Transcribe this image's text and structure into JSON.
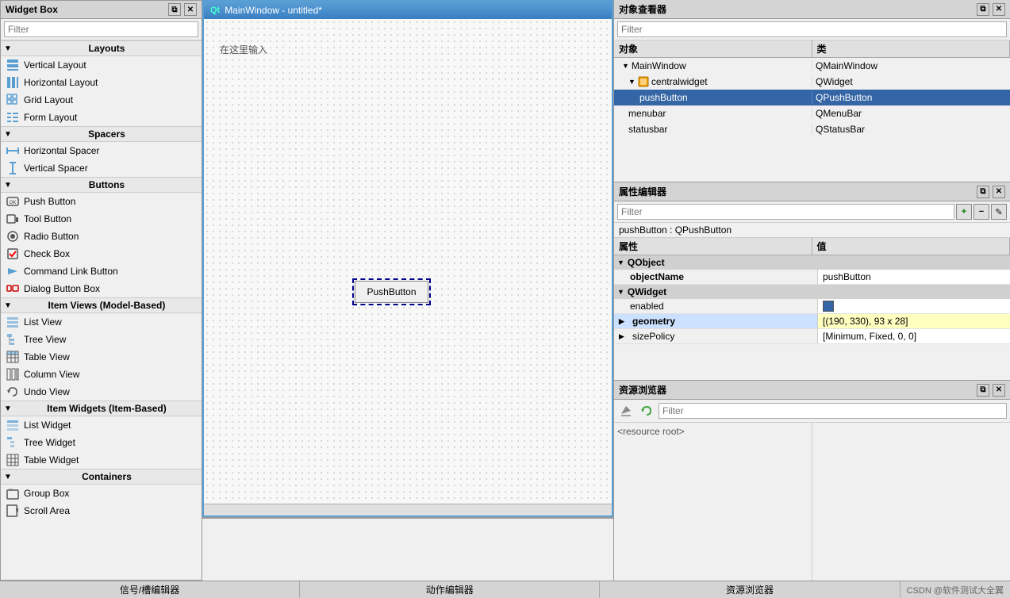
{
  "widgetBox": {
    "title": "Widget Box",
    "filterPlaceholder": "Filter",
    "sections": [
      {
        "name": "Layouts",
        "items": [
          {
            "id": "vertical-layout",
            "label": "Vertical Layout",
            "icon": "vlayout"
          },
          {
            "id": "horizontal-layout",
            "label": "Horizontal Layout",
            "icon": "hlayout"
          },
          {
            "id": "grid-layout",
            "label": "Grid Layout",
            "icon": "grid"
          },
          {
            "id": "form-layout",
            "label": "Form Layout",
            "icon": "form"
          }
        ]
      },
      {
        "name": "Spacers",
        "items": [
          {
            "id": "horizontal-spacer",
            "label": "Horizontal Spacer",
            "icon": "hspacer"
          },
          {
            "id": "vertical-spacer",
            "label": "Vertical Spacer",
            "icon": "vspacer"
          }
        ]
      },
      {
        "name": "Buttons",
        "items": [
          {
            "id": "push-button",
            "label": "Push Button",
            "icon": "pushbtn"
          },
          {
            "id": "tool-button",
            "label": "Tool Button",
            "icon": "toolbtn"
          },
          {
            "id": "radio-button",
            "label": "Radio Button",
            "icon": "radiobtn"
          },
          {
            "id": "check-box",
            "label": "Check Box",
            "icon": "checkbox"
          },
          {
            "id": "command-link-button",
            "label": "Command Link Button",
            "icon": "cmdlink"
          },
          {
            "id": "dialog-button-box",
            "label": "Dialog Button Box",
            "icon": "dialogbox"
          }
        ]
      },
      {
        "name": "Item Views (Model-Based)",
        "items": [
          {
            "id": "list-view",
            "label": "List View",
            "icon": "listview"
          },
          {
            "id": "tree-view",
            "label": "Tree View",
            "icon": "treeview"
          },
          {
            "id": "table-view",
            "label": "Table View",
            "icon": "tableview"
          },
          {
            "id": "column-view",
            "label": "Column View",
            "icon": "columnview"
          },
          {
            "id": "undo-view",
            "label": "Undo View",
            "icon": "undoview"
          }
        ]
      },
      {
        "name": "Item Widgets (Item-Based)",
        "items": [
          {
            "id": "list-widget",
            "label": "List Widget",
            "icon": "listwidget"
          },
          {
            "id": "tree-widget",
            "label": "Tree Widget",
            "icon": "treewidget"
          },
          {
            "id": "table-widget",
            "label": "Table Widget",
            "icon": "tablewidget"
          }
        ]
      },
      {
        "name": "Containers",
        "items": [
          {
            "id": "group-box",
            "label": "Group Box",
            "icon": "groupbox"
          },
          {
            "id": "scroll-area",
            "label": "Scroll Area",
            "icon": "scrollarea"
          }
        ]
      }
    ]
  },
  "designer": {
    "title": "MainWindow - untitled*",
    "placeholder": "在这里输入",
    "pushButtonLabel": "PushButton"
  },
  "objectInspector": {
    "title": "对象查看器",
    "filterPlaceholder": "Filter",
    "columns": [
      "对象",
      "类"
    ],
    "tree": [
      {
        "name": "MainWindow",
        "class": "QMainWindow",
        "level": 0,
        "expanded": true,
        "hasChildren": true
      },
      {
        "name": "centralwidget",
        "class": "QWidget",
        "level": 1,
        "expanded": true,
        "hasChildren": true,
        "icon": "widget"
      },
      {
        "name": "pushButton",
        "class": "QPushButton",
        "level": 2,
        "hasChildren": false,
        "selected": true
      },
      {
        "name": "menubar",
        "class": "QMenuBar",
        "level": 1,
        "hasChildren": false
      },
      {
        "name": "statusbar",
        "class": "QStatusBar",
        "level": 1,
        "hasChildren": false
      }
    ]
  },
  "propertyEditor": {
    "title": "属性编辑器",
    "filterPlaceholder": "Filter",
    "subtitle": "pushButton : QPushButton",
    "columns": [
      "属性",
      "值"
    ],
    "filterBtns": [
      "+",
      "-",
      "✎"
    ],
    "sections": [
      {
        "name": "QObject",
        "expanded": true,
        "properties": [
          {
            "name": "objectName",
            "value": "pushButton",
            "bold": true,
            "highlight": false
          }
        ]
      },
      {
        "name": "QWidget",
        "expanded": true,
        "properties": [
          {
            "name": "enabled",
            "value": "☑",
            "bold": false,
            "highlight": false,
            "isCheckbox": true
          },
          {
            "name": "geometry",
            "value": "[(190, 330), 93 x 28]",
            "bold": true,
            "highlight": true,
            "expandable": true
          },
          {
            "name": "sizePolicy",
            "value": "[Minimum, Fixed, 0, 0]",
            "bold": false,
            "highlight": false,
            "expandable": true
          }
        ]
      }
    ]
  },
  "resourceBrowser": {
    "title": "资源浏览器",
    "filterPlaceholder": "Filter",
    "rootLabel": "<resource root>"
  },
  "bottomTabs": [
    {
      "label": "信号/槽编辑器"
    },
    {
      "label": "动作编辑器"
    },
    {
      "label": "资源浏览器"
    }
  ],
  "watermark": "CSDN @软件测试大全翼"
}
